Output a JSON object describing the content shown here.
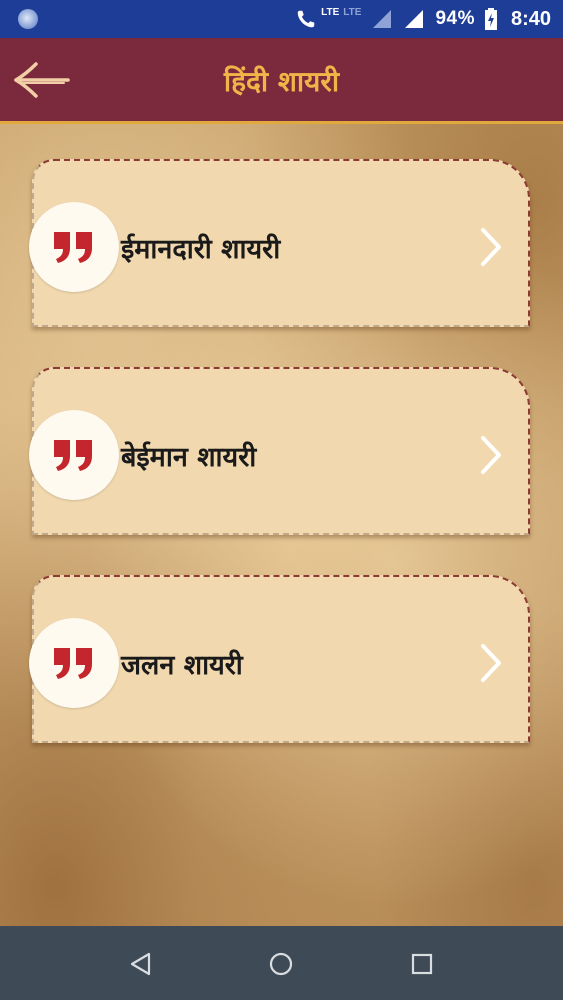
{
  "status_bar": {
    "lte_label": "LTE",
    "lte2_label": "LTE",
    "battery_percent": "94%",
    "time": "8:40"
  },
  "app_bar": {
    "title": "हिंदी शायरी",
    "back_icon": "arrow-left-icon",
    "title_color": "#f2b449",
    "background": "#7a2a3c"
  },
  "categories": [
    {
      "label": "ईमानदारी शायरी",
      "icon": "quote-icon"
    },
    {
      "label": "बेईमान शायरी",
      "icon": "quote-icon"
    },
    {
      "label": "जलन शायरी",
      "icon": "quote-icon"
    }
  ],
  "nav_bar": {
    "back": "triangle-back-icon",
    "home": "circle-home-icon",
    "recents": "square-recents-icon"
  }
}
